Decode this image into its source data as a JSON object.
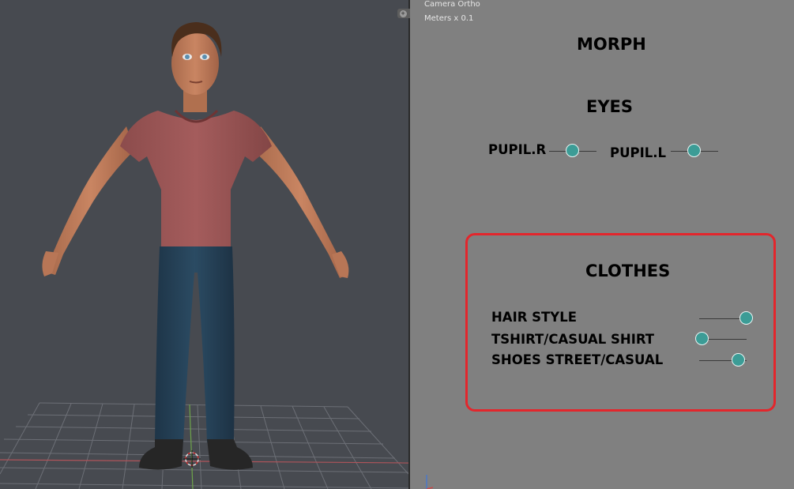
{
  "viewport": {
    "overlay": {
      "line1": "Camera Ortho",
      "line2": "Meters x 0.1"
    }
  },
  "panel": {
    "title": "MORPH",
    "eyes": {
      "heading": "EYES",
      "pupil_r": {
        "label": "PUPIL.R",
        "value": 0.5
      },
      "pupil_l": {
        "label": "PUPIL.L",
        "value": 0.5
      }
    },
    "clothes": {
      "heading": "CLOTHES",
      "rows": [
        {
          "label": "HAIR STYLE",
          "value": 1.0
        },
        {
          "label": "TSHIRT/CASUAL SHIRT",
          "value": 0.0
        },
        {
          "label": "SHOES STREET/CASUAL",
          "value": 0.83
        }
      ]
    }
  },
  "colors": {
    "viewport_bg": "#474a50",
    "panel_bg": "#808080",
    "slider_knob": "#3c9c96",
    "highlight_border": "#e3262c"
  },
  "icons": {
    "nav_gizmo": "viewport-navigation-icon",
    "origin": "3d-cursor-icon",
    "axis": "axis-gizmo-icon"
  }
}
